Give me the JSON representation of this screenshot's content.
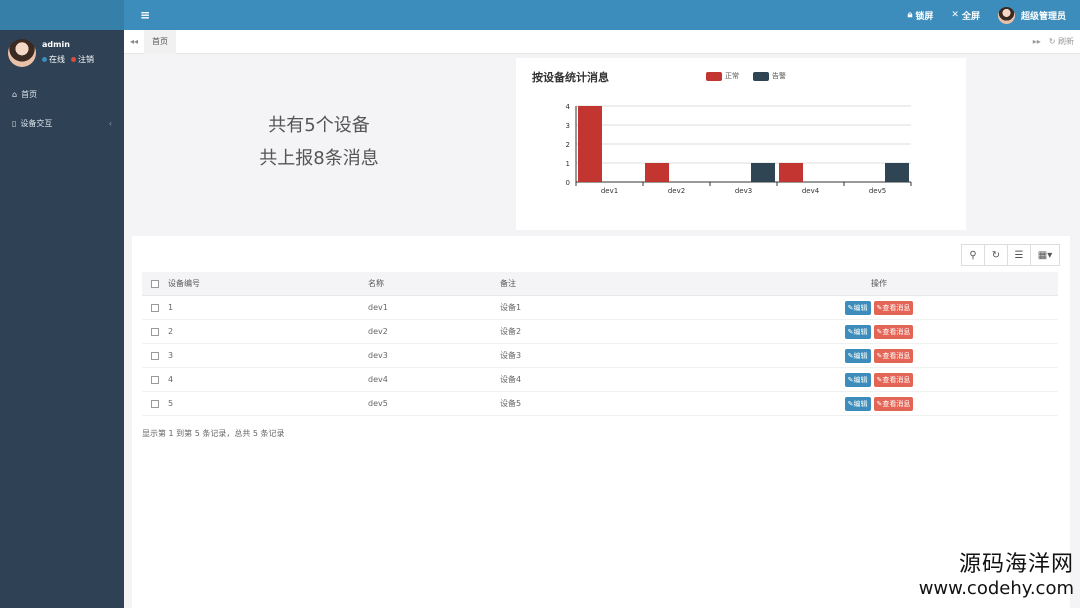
{
  "header": {
    "menu_toggle_glyph": "≡",
    "lock_icon": "lock-icon",
    "lock_label": "锁屏",
    "fullscreen_label": "全屏",
    "user_label": "超级管理员"
  },
  "sidebar": {
    "user_name": "admin",
    "status_online": "在线",
    "status_logout": "注销",
    "items": [
      {
        "icon": "home-icon",
        "label": "首页"
      },
      {
        "icon": "device-icon",
        "label": "设备交互"
      }
    ]
  },
  "tabs": {
    "active": "首页",
    "refresh_label": "刷新"
  },
  "stats": {
    "line1": "共有5个设备",
    "line2": "共上报8条消息"
  },
  "colors": {
    "normal": "#c23531",
    "alert": "#2f4554",
    "primary": "#3c8dbc"
  },
  "chart_data": {
    "type": "bar",
    "title": "按设备统计消息",
    "categories": [
      "dev1",
      "dev2",
      "dev3",
      "dev4",
      "dev5"
    ],
    "series": [
      {
        "name": "正常",
        "values": [
          4,
          1,
          0,
          1,
          0
        ]
      },
      {
        "name": "告警",
        "values": [
          0,
          0,
          1,
          0,
          1
        ]
      }
    ],
    "ylim": [
      0,
      4
    ],
    "yticks": [
      0,
      1,
      2,
      3,
      4
    ],
    "grid": true,
    "legend_position": "top"
  },
  "table": {
    "columns": [
      "设备编号",
      "名称",
      "备注",
      "操作"
    ],
    "rows": [
      {
        "id": "1",
        "name": "dev1",
        "note": "设备1"
      },
      {
        "id": "2",
        "name": "dev2",
        "note": "设备2"
      },
      {
        "id": "3",
        "name": "dev3",
        "note": "设备3"
      },
      {
        "id": "4",
        "name": "dev4",
        "note": "设备4"
      },
      {
        "id": "5",
        "name": "dev5",
        "note": "设备5"
      }
    ],
    "edit_label": "编辑",
    "view_label": "查看消息",
    "summary": "显示第 1 到第 5 条记录，总共 5 条记录"
  },
  "watermark": {
    "line1": "源码海洋网",
    "line2": "www.codehy.com"
  }
}
